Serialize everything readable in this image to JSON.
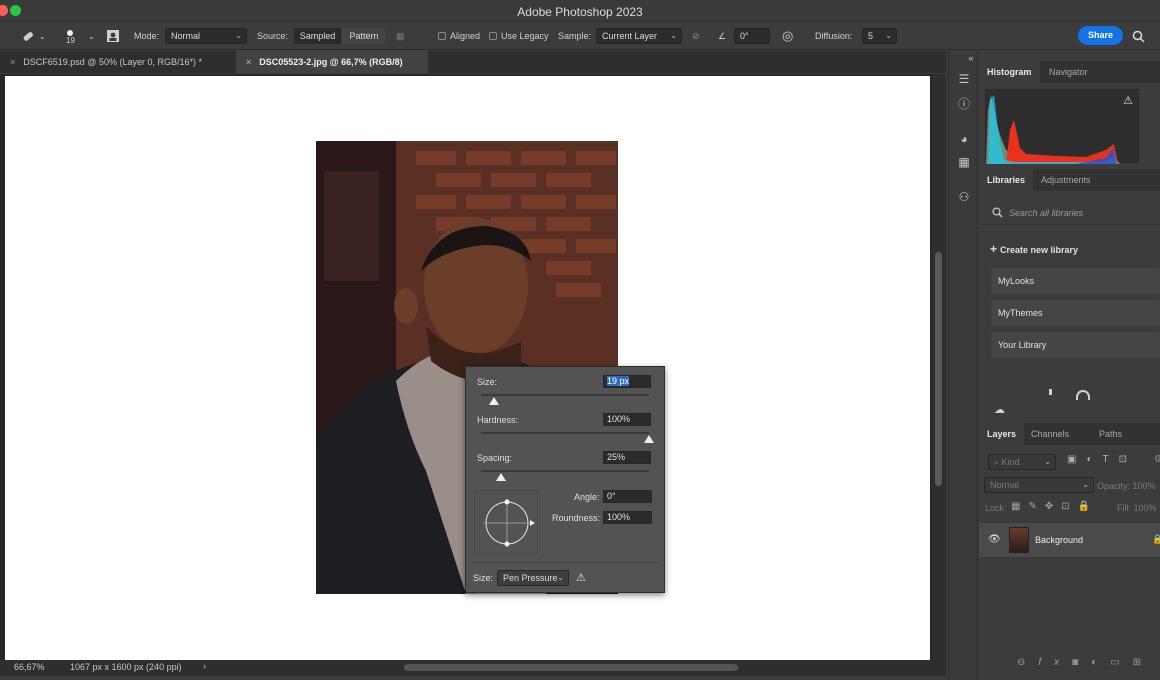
{
  "window": {
    "title": "Adobe Photoshop 2023",
    "light_colors": [
      "#ff5f57",
      "#28c840"
    ]
  },
  "options_bar": {
    "brush_size": "19",
    "mode_label": "Mode:",
    "mode_value": "Normal",
    "source_label": "Source:",
    "source_sampled": "Sampled",
    "source_pattern": "Pattern",
    "aligned": "Aligned",
    "use_legacy": "Use Legacy",
    "sample_label": "Sample:",
    "sample_value": "Current Layer",
    "angle_value": "0°",
    "diffusion_label": "Diffusion:",
    "diffusion_value": "5",
    "share": "Share"
  },
  "tabs": [
    {
      "label": "DSCF6519.psd @ 50% (Layer 0, RGB/16*) *"
    },
    {
      "label": "DSC05523-2.jpg @ 66,7% (RGB/8)"
    }
  ],
  "status": {
    "zoom": "66,67%",
    "dimensions": "1067 px x 1600 px (240 ppi)",
    "more": "›"
  },
  "brush_popup": {
    "size_label": "Size:",
    "size_value": "19 px",
    "size_level": 0.08,
    "hardness_label": "Hardness:",
    "hardness_value": "100%",
    "hardness_level": 1.0,
    "spacing_label": "Spacing:",
    "spacing_value": "25%",
    "spacing_level": 0.12,
    "angle_label": "Angle:",
    "angle_value": "0°",
    "roundness_label": "Roundness:",
    "roundness_value": "100%",
    "size_control_label": "Size:",
    "size_control_value": "Pen Pressure"
  },
  "panels": {
    "histogram_tabs": [
      "Histogram",
      "Navigator"
    ],
    "libraries_tabs": [
      "Libraries",
      "Adjustments"
    ],
    "search_placeholder": "Search all libraries",
    "create_library": "Create new library",
    "libraries": [
      "MyLooks",
      "MyThemes",
      "Your Library"
    ],
    "layers_tabs": [
      "Layers",
      "Channels",
      "Paths"
    ],
    "kind": "Kind",
    "blend_mode": "Normal",
    "opacity_label": "Opacity:",
    "opacity_value": "100%",
    "lock_label": "Lock:",
    "fill_label": "Fill:",
    "fill_value": "100%",
    "layer_name": "Background"
  },
  "accent_color": "#1473e6"
}
